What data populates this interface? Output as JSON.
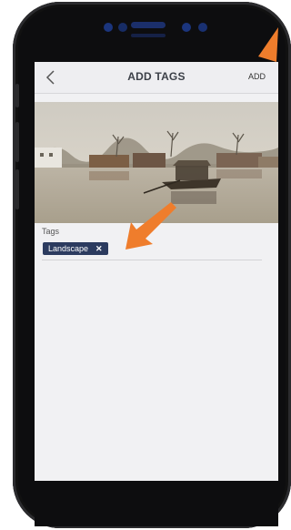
{
  "navbar": {
    "title": "ADD TAGS",
    "add_label": "ADD"
  },
  "tags": {
    "label": "Tags",
    "items": [
      {
        "label": "Landscape",
        "remove": "✕"
      }
    ]
  },
  "colors": {
    "chip": "#2c3b5f",
    "arrow": "#ef7d2c",
    "screen": "#f1f1f3"
  },
  "icons": {
    "back": "chevron-left-icon",
    "remove": "close-icon"
  }
}
